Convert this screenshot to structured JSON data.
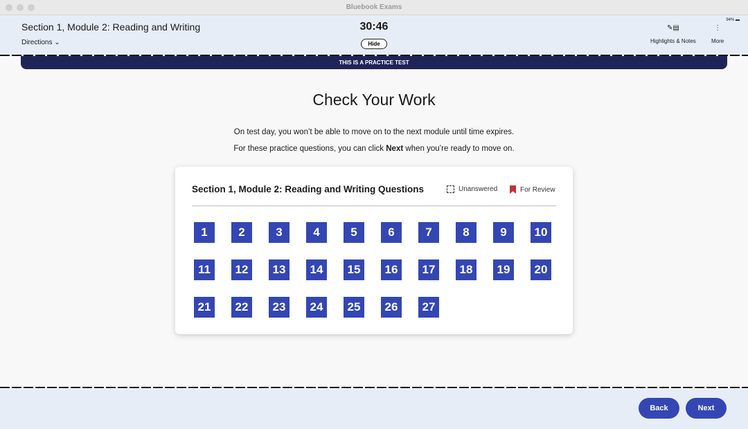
{
  "window": {
    "title": "Bluebook Exams"
  },
  "header": {
    "section": "Section 1, Module 2: Reading and Writing",
    "directions": "Directions",
    "timer": "30:46",
    "hide": "Hide",
    "battery": "94%",
    "highlights": "Highlights & Notes",
    "more": "More"
  },
  "banner": "THIS IS A PRACTICE TEST",
  "main": {
    "title": "Check Your Work",
    "line1": "On test day, you won’t be able to move on to the next module until time expires.",
    "line2_pre": "For these practice questions, you can click ",
    "line2_bold": "Next",
    "line2_post": " when you’re ready to move on."
  },
  "card": {
    "title": "Section 1, Module 2: Reading and Writing Questions",
    "legend_unanswered": "Unanswered",
    "legend_review": "For Review",
    "questions": [
      "1",
      "2",
      "3",
      "4",
      "5",
      "6",
      "7",
      "8",
      "9",
      "10",
      "11",
      "12",
      "13",
      "14",
      "15",
      "16",
      "17",
      "18",
      "19",
      "20",
      "21",
      "22",
      "23",
      "24",
      "25",
      "26",
      "27"
    ]
  },
  "footer": {
    "back": "Back",
    "next": "Next"
  },
  "colors": {
    "accent": "#3346b4",
    "banner": "#1f2458",
    "header": "#e6edf6",
    "review": "#c0323a"
  }
}
